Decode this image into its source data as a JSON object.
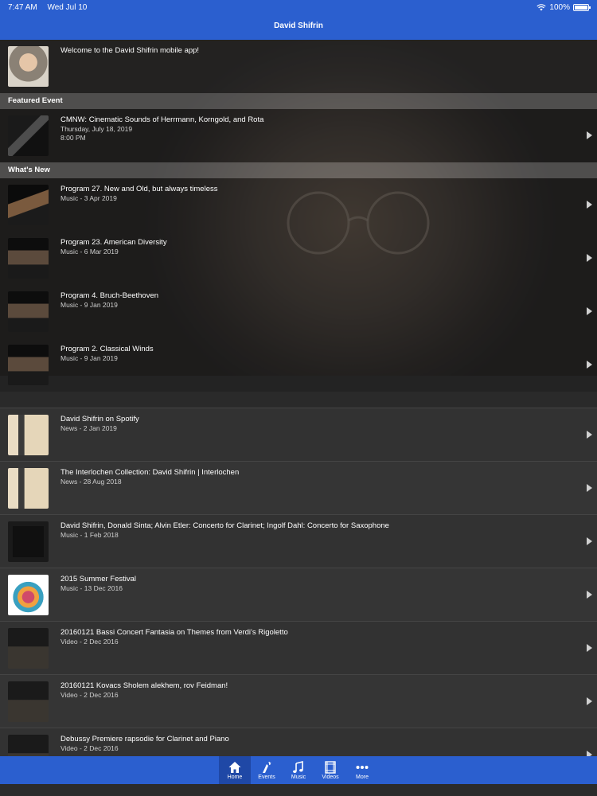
{
  "status": {
    "time": "7:47 AM",
    "date": "Wed Jul 10",
    "battery": "100%"
  },
  "nav": {
    "title": "David Shifrin"
  },
  "welcome": {
    "text": "Welcome to the David Shifrin mobile app!"
  },
  "sections": {
    "featured": "Featured Event",
    "whats_new": "What's New"
  },
  "featured": {
    "title": "CMNW: Cinematic Sounds of Herrmann, Korngold, and Rota",
    "date": "Thursday, July 18, 2019",
    "time": "8:00 PM"
  },
  "items": [
    {
      "title": "Program 27. New and Old, but always timeless",
      "sub": "Music - 3 Apr 2019"
    },
    {
      "title": "Program 23. American Diversity",
      "sub": "Music - 6 Mar 2019"
    },
    {
      "title": "Program 4. Bruch-Beethoven",
      "sub": "Music - 9 Jan 2019"
    },
    {
      "title": "Program 2. Classical Winds",
      "sub": "Music - 9 Jan 2019"
    },
    {
      "title": "David Shifrin on Spotify",
      "sub": "News - 2 Jan 2019"
    },
    {
      "title": "The Interlochen Collection: David Shifrin | Interlochen",
      "sub": "News - 28 Aug 2018"
    },
    {
      "title": "David Shifrin, Donald Sinta; Alvin Etler: Concerto for Clarinet; Ingolf Dahl: Concerto for Saxophone",
      "sub": "Music - 1 Feb 2018"
    },
    {
      "title": "2015 Summer Festival",
      "sub": "Music - 13 Dec 2016"
    },
    {
      "title": "20160121 Bassi Concert Fantasia on Themes from Verdi's Rigoletto",
      "sub": "Video - 2 Dec 2016"
    },
    {
      "title": "20160121 Kovacs Sholem alekhem, rov Feidman!",
      "sub": "Video - 2 Dec 2016"
    },
    {
      "title": "Debussy Premiere rapsodie for Clarinet and Piano",
      "sub": "Video - 2 Dec 2016"
    }
  ],
  "tabs": [
    {
      "label": "Home",
      "icon": "home-icon"
    },
    {
      "label": "Events",
      "icon": "events-icon"
    },
    {
      "label": "Music",
      "icon": "music-note-icon"
    },
    {
      "label": "Videos",
      "icon": "film-icon"
    },
    {
      "label": "More",
      "icon": "more-dots-icon"
    }
  ],
  "colors": {
    "accent": "#2b5fcf",
    "tab_active": "#1f48a6",
    "background": "#2b2b2b"
  }
}
